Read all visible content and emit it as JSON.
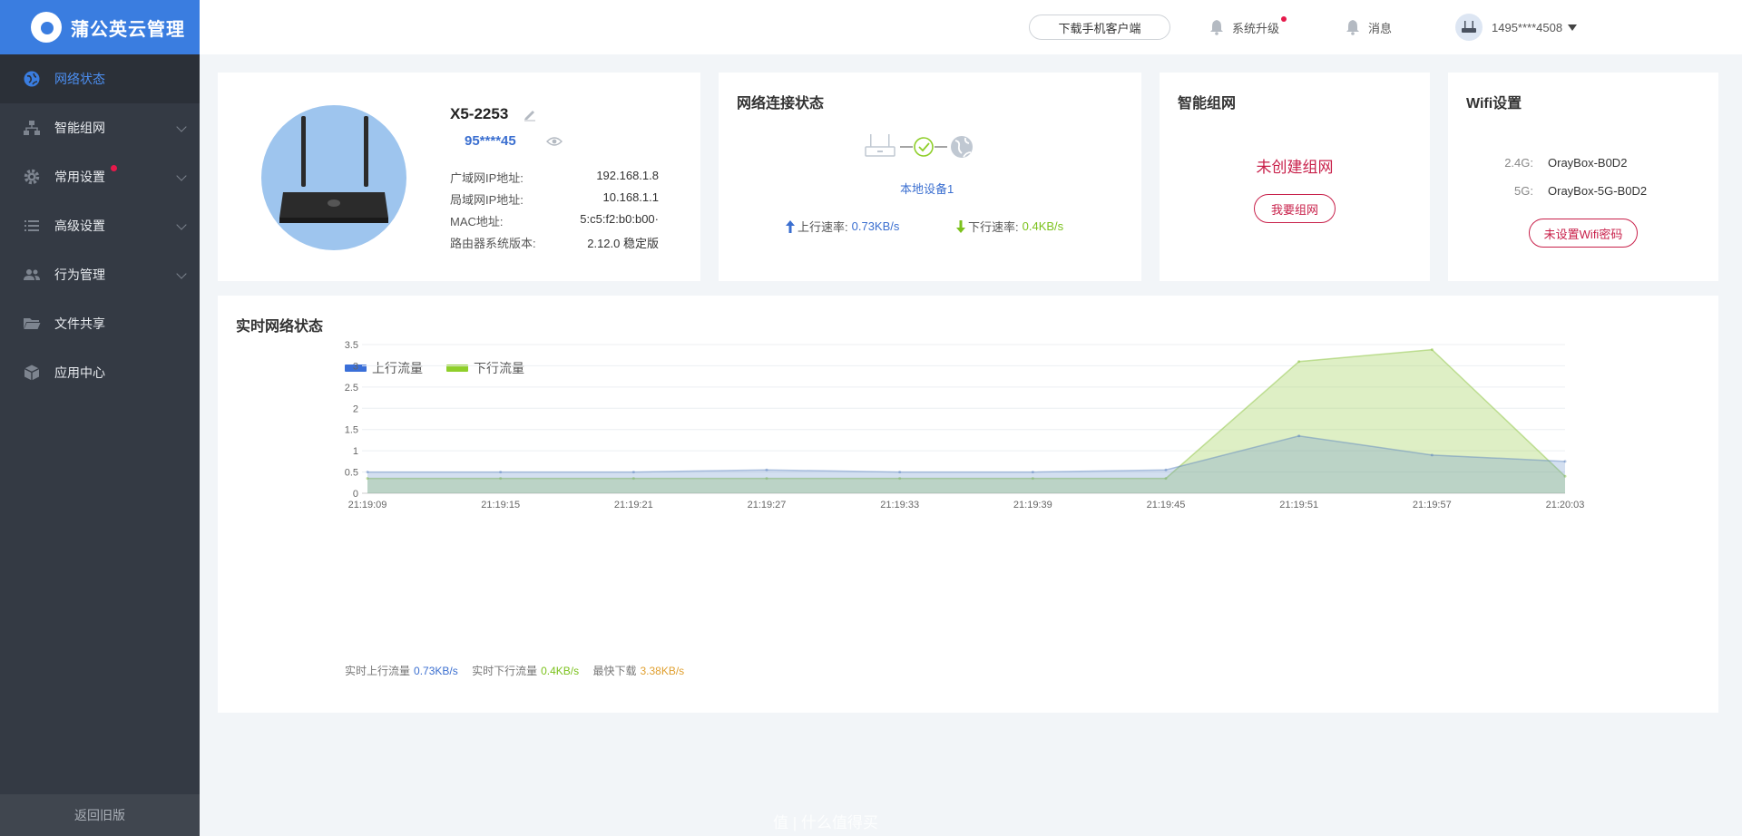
{
  "app": {
    "logo_text": "蒲公英云管理"
  },
  "sidebar": {
    "items": [
      {
        "label": "网络状态",
        "icon": "globe-icon",
        "active": true
      },
      {
        "label": "智能组网",
        "icon": "network-icon"
      },
      {
        "label": "常用设置",
        "icon": "gear-icon"
      },
      {
        "label": "高级设置",
        "icon": "list-icon"
      },
      {
        "label": "行为管理",
        "icon": "users-icon"
      },
      {
        "label": "文件共享",
        "icon": "folder-icon"
      },
      {
        "label": "应用中心",
        "icon": "cube-icon"
      }
    ],
    "back_label": "返回旧版"
  },
  "header": {
    "download_label": "下载手机客户端",
    "upgrade_label": "系统升级",
    "messages_label": "消息",
    "account": "1495****4508"
  },
  "device": {
    "name": "X5-2253",
    "sn": "95****45",
    "rows": [
      {
        "key": "广域网IP地址:",
        "value": "192.168.1.8"
      },
      {
        "key": "局域网IP地址:",
        "value": "10.168.1.1"
      },
      {
        "key": "MAC地址:",
        "value": "5:c5:f2:b0:b00·"
      },
      {
        "key": "路由器系统版本:",
        "value": "2.12.0 稳定版"
      }
    ]
  },
  "network": {
    "title": "网络连接状态",
    "device_label": "本地设备1",
    "up_label": "上行速率:",
    "up_value": "0.73KB/s",
    "down_label": "下行速率:",
    "down_value": "0.4KB/s"
  },
  "smartnet": {
    "title": "智能组网",
    "status": "未创建组网",
    "button": "我要组网"
  },
  "wifi": {
    "title": "Wifi设置",
    "band1_label": "2.4G:",
    "band1_ssid": "OrayBox-B0D2",
    "band2_label": "5G:",
    "band2_ssid": "OrayBox-5G-B0D2",
    "button": "未设置Wifi密码"
  },
  "realtime": {
    "title": "实时网络状态",
    "stats": {
      "up_label": "实时上行流量",
      "up_value": "0.73KB/s",
      "down_label": "实时下行流量",
      "down_value": "0.4KB/s",
      "max_label": "最快下载",
      "max_value": "3.38KB/s"
    }
  },
  "chart_data": {
    "type": "area",
    "series": [
      {
        "name": "上行流量",
        "color": "#3a6fd8",
        "values": [
          0.5,
          0.5,
          0.5,
          0.55,
          0.5,
          0.5,
          0.55,
          1.35,
          0.9,
          0.75
        ]
      },
      {
        "name": "下行流量",
        "color": "#8fcf2a",
        "values": [
          0.35,
          0.35,
          0.35,
          0.35,
          0.35,
          0.35,
          0.35,
          3.1,
          3.38,
          0.4
        ]
      }
    ],
    "x": [
      "21:19:09",
      "21:19:15",
      "21:19:21",
      "21:19:27",
      "21:19:33",
      "21:19:39",
      "21:19:45",
      "21:19:51",
      "21:19:57",
      "21:20:03"
    ],
    "y_ticks": [
      "0",
      "0.5",
      "1",
      "1.5",
      "2",
      "2.5",
      "3",
      "3.5"
    ],
    "ylim": [
      0,
      3.5
    ],
    "grid": true,
    "legend": "top-left"
  },
  "watermark": "值 | 什么值得买"
}
